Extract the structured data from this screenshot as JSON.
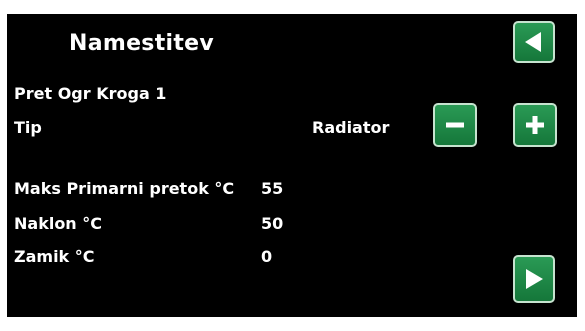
{
  "screen": {
    "title": "Namestitev",
    "rows": [
      {
        "label": "Pret Ogr Kroga 1",
        "value": ""
      },
      {
        "label": "Tip",
        "value": "Radiator"
      },
      {
        "label": "Maks Primarni pretok °C",
        "value": "55"
      },
      {
        "label": "Naklon °C",
        "value": "50"
      },
      {
        "label": "Zamik °C",
        "value": "0"
      }
    ]
  },
  "buttons": {
    "back": {
      "icon": "back-triangle-icon"
    },
    "minus": {
      "icon": "minus-icon"
    },
    "plus": {
      "icon": "plus-icon"
    },
    "next": {
      "icon": "next-triangle-icon"
    }
  },
  "colors": {
    "background": "#000000",
    "text": "#ffffff",
    "button_green": "#1f8a48",
    "button_border": "#c6e3cf"
  }
}
